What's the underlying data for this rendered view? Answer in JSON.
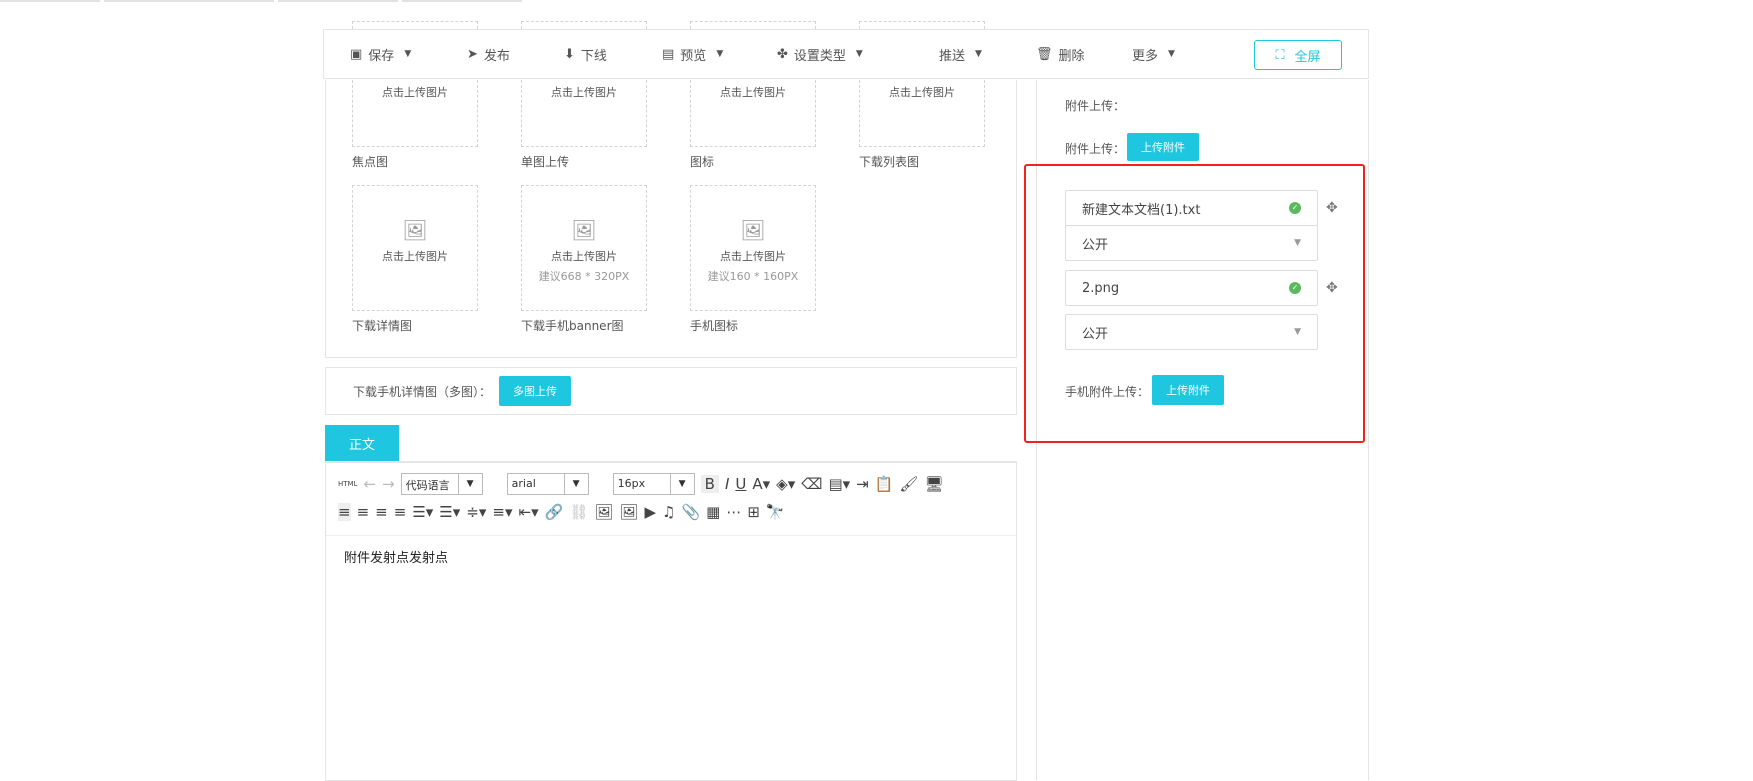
{
  "toolbar": {
    "save": "保存",
    "publish": "发布",
    "offline": "下线",
    "preview": "预览",
    "set_type": "设置类型",
    "push": "推送",
    "delete": "删除",
    "more": "更多",
    "fullscreen": "全屏"
  },
  "uploads": [
    {
      "btn": "点击上传图片",
      "caption": "焦点图"
    },
    {
      "btn": "点击上传图片",
      "caption": "单图上传"
    },
    {
      "btn": "点击上传图片",
      "caption": "图标"
    },
    {
      "btn": "点击上传图片",
      "caption": "下载列表图"
    },
    {
      "btn": "点击上传图片",
      "caption": "下载详情图"
    },
    {
      "btn": "点击上传图片",
      "hint": "建议668 * 320PX",
      "caption": "下载手机banner图"
    },
    {
      "btn": "点击上传图片",
      "hint": "建议160 * 160PX",
      "caption": "手机图标"
    }
  ],
  "multi": {
    "label": "下载手机详情图（多图）：",
    "button": "多图上传"
  },
  "tab": "正文",
  "editor": {
    "html": "HTML",
    "code_lang": "代码语言",
    "font": "arial",
    "size": "16px",
    "content": "附件发射点发射点"
  },
  "side": {
    "attach_label1": "附件上传：",
    "attach_label2": "附件上传：",
    "attach_btn": "上传附件",
    "files": [
      {
        "name": "新建文本文档(1).txt",
        "visibility": "公开"
      },
      {
        "name": "2.png",
        "visibility": "公开"
      }
    ],
    "mobile_label": "手机附件上传：",
    "mobile_btn": "上传附件"
  }
}
